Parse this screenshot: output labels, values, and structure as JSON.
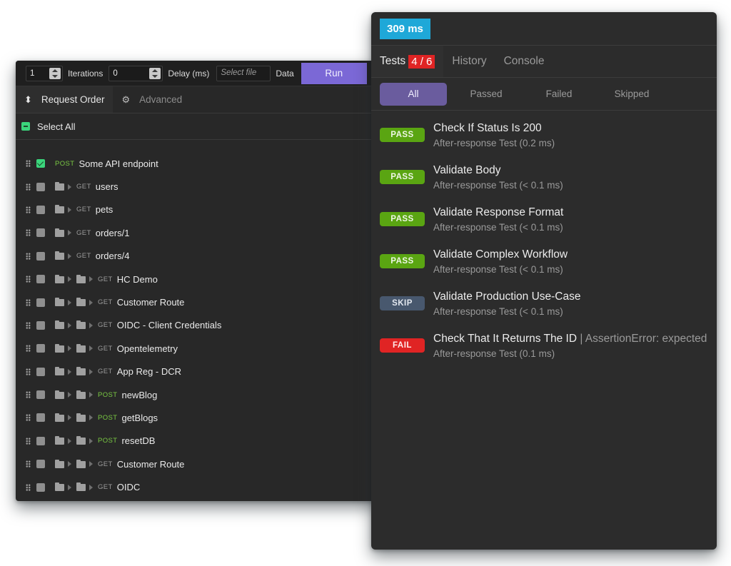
{
  "runner": {
    "iterations_value": "1",
    "iterations_label": "Iterations",
    "delay_value": "0",
    "delay_label": "Delay (ms)",
    "file_placeholder": "Select file",
    "data_label": "Data",
    "run_label": "Run",
    "tabs": [
      {
        "label": "Request Order",
        "icon": "sort-arrows-icon",
        "active": true
      },
      {
        "label": "Advanced",
        "icon": "gear-icon",
        "active": false
      }
    ],
    "select_all_label": "Select All",
    "requests": [
      {
        "method": "POST",
        "name": "Some API endpoint",
        "checked": true,
        "folders": 0
      },
      {
        "method": "GET",
        "name": "users",
        "checked": false,
        "folders": 1
      },
      {
        "method": "GET",
        "name": "pets",
        "checked": false,
        "folders": 1
      },
      {
        "method": "GET",
        "name": "orders/1",
        "checked": false,
        "folders": 1
      },
      {
        "method": "GET",
        "name": "orders/4",
        "checked": false,
        "folders": 1
      },
      {
        "method": "GET",
        "name": "HC Demo",
        "checked": false,
        "folders": 2
      },
      {
        "method": "GET",
        "name": "Customer Route",
        "checked": false,
        "folders": 2
      },
      {
        "method": "GET",
        "name": "OIDC - Client Credentials",
        "checked": false,
        "folders": 2
      },
      {
        "method": "GET",
        "name": "Opentelemetry",
        "checked": false,
        "folders": 2
      },
      {
        "method": "GET",
        "name": "App Reg - DCR",
        "checked": false,
        "folders": 2
      },
      {
        "method": "POST",
        "name": "newBlog",
        "checked": false,
        "folders": 2
      },
      {
        "method": "POST",
        "name": "getBlogs",
        "checked": false,
        "folders": 2
      },
      {
        "method": "POST",
        "name": "resetDB",
        "checked": false,
        "folders": 2
      },
      {
        "method": "GET",
        "name": "Customer Route",
        "checked": false,
        "folders": 2
      },
      {
        "method": "GET",
        "name": "OIDC",
        "checked": false,
        "folders": 2
      }
    ]
  },
  "tests_panel": {
    "timing": "309 ms",
    "tabs": [
      {
        "label": "Tests",
        "badge": "4 / 6",
        "active": true
      },
      {
        "label": "History",
        "active": false
      },
      {
        "label": "Console",
        "active": false
      }
    ],
    "filters": [
      {
        "label": "All",
        "active": true
      },
      {
        "label": "Passed",
        "active": false
      },
      {
        "label": "Failed",
        "active": false
      },
      {
        "label": "Skipped",
        "active": false
      }
    ],
    "results": [
      {
        "status": "PASS",
        "title": "Check If Status Is 200",
        "error": "",
        "detail": "After-response Test (0.2 ms)"
      },
      {
        "status": "PASS",
        "title": "Validate Body",
        "error": "",
        "detail": "After-response Test (< 0.1 ms)"
      },
      {
        "status": "PASS",
        "title": "Validate Response Format",
        "error": "",
        "detail": "After-response Test (< 0.1 ms)"
      },
      {
        "status": "PASS",
        "title": "Validate Complex Workflow",
        "error": "",
        "detail": "After-response Test (< 0.1 ms)"
      },
      {
        "status": "SKIP",
        "title": "Validate Production Use-Case",
        "error": "",
        "detail": "After-response Test (< 0.1 ms)"
      },
      {
        "status": "FAIL",
        "title": "Check That It Returns The ID",
        "error": " | AssertionError: expected",
        "detail": "After-response Test (0.1 ms)"
      }
    ]
  },
  "colors": {
    "run_button": "#7b68d6",
    "timing_badge": "#1fa8d8",
    "pass": "#5aa512",
    "skip": "#48586e",
    "fail": "#e02424",
    "post_method": "#7ac943",
    "active_filter": "#6a5c9e"
  }
}
